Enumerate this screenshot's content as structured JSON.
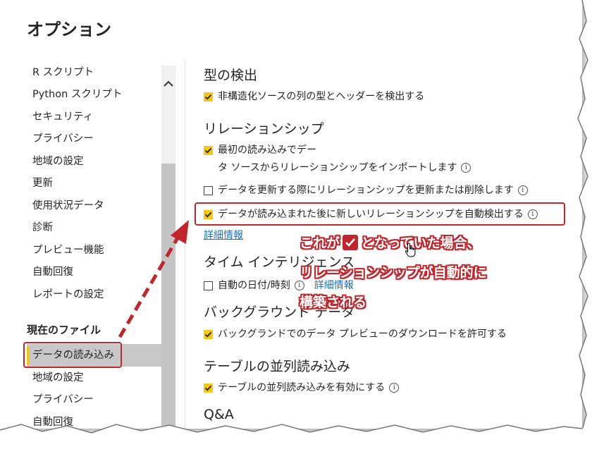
{
  "dialog": {
    "title": "オプション"
  },
  "nav": {
    "global_items": [
      "R スクリプト",
      "Python スクリプト",
      "セキュリティ",
      "プライバシー",
      "地域の設定",
      "更新",
      "使用状況データ",
      "診断",
      "プレビュー機能",
      "自動回復",
      "レポートの設定"
    ],
    "current_file_header": "現在のファイル",
    "current_file_items": [
      "データの読み込み",
      "地域の設定",
      "プライバシー",
      "自動回復"
    ],
    "selected_index": 0
  },
  "content": {
    "type_detection": {
      "title": "型の検出",
      "opt1": {
        "label": "非構造化ソースの列の型とヘッダーを検出する",
        "checked": true
      }
    },
    "relationships": {
      "title": "リレーションシップ",
      "opt1": {
        "label_line1": "最初の読み込みでデー",
        "label_line2": "タ ソースからリレーションシップをインポートします",
        "checked": true
      },
      "opt2": {
        "label": "データを更新する際にリレーションシップを更新または削除します",
        "checked": false
      },
      "opt3": {
        "label": "データが読み込まれた後に新しいリレーションシップを自動検出する",
        "checked": true
      },
      "learn_more": "詳細情報"
    },
    "time_intelligence": {
      "title": "タイム インテリジェンス",
      "opt1": {
        "label": "自動の日付/時刻",
        "checked": false
      },
      "learn_more": "詳細情報"
    },
    "background": {
      "title": "バックグラウンド データ",
      "opt1": {
        "label": "バックグランドでのデータ プレビューのダウンロードを許可する",
        "checked": true
      }
    },
    "parallel": {
      "title": "テーブルの並列読み込み",
      "opt1": {
        "label": "テーブルの並列読み込みを有効にする",
        "checked": true
      }
    },
    "qa": {
      "title": "Q&A"
    }
  },
  "annotation": {
    "line1_before": "これが",
    "line1_after": "となっていた場合、",
    "line2": "リレーションシップが自動的に",
    "line3": "構築される",
    "color": "#c0272d"
  },
  "colors": {
    "accent": "#f2c811",
    "link": "#1c6fbe",
    "annotation": "#c0272d"
  }
}
